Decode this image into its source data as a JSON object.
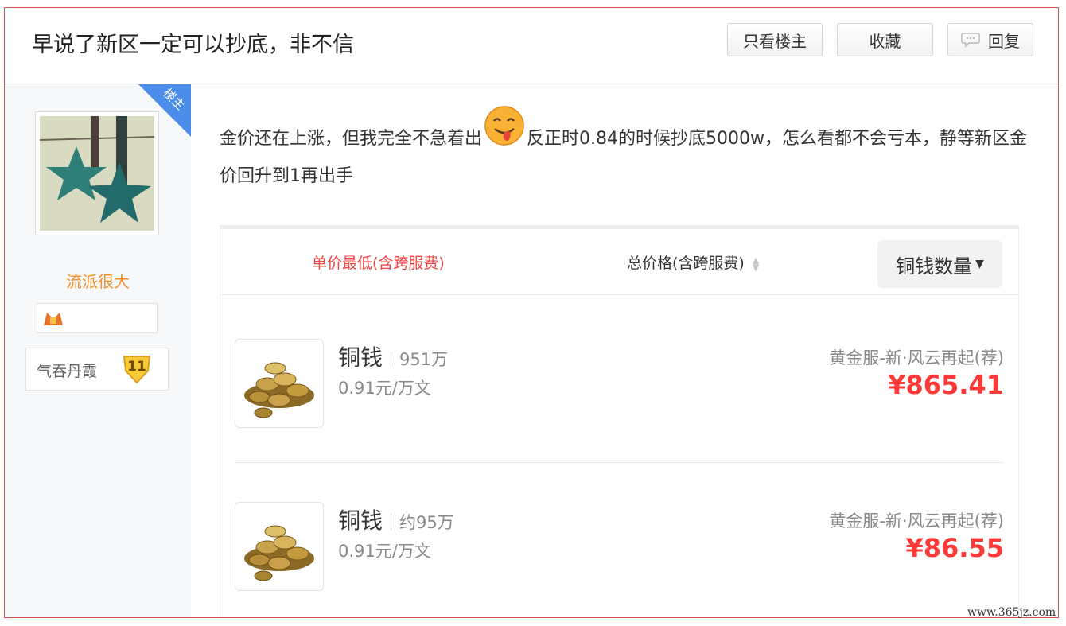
{
  "header": {
    "title": "早说了新区一定可以抄底，非不信",
    "only_op_label": "只看楼主",
    "favorite_label": "收藏",
    "reply_label": "回复"
  },
  "author": {
    "ribbon_label": "楼主",
    "username": "流派很大",
    "level_name": "气吞丹霞",
    "level": "11"
  },
  "post": {
    "text_before_emoji": "金价还在上涨，但我完全不急着出",
    "text_after_emoji": "反正时0.84的时候抄底5000w，怎么看都不会亏本，静等新区金价回升到1再出手"
  },
  "listing": {
    "sort_unit_label": "单价最低(含跨服费)",
    "sort_total_label": "总价格(含跨服费)",
    "sort_qty_label": "铜钱数量",
    "items": [
      {
        "name": "铜钱",
        "amount": "951万",
        "unit_price": "0.91元/万文",
        "server": "黄金服-新·风云再起(荐)",
        "price": "¥865.41"
      },
      {
        "name": "铜钱",
        "amount": "约95万",
        "unit_price": "0.91元/万文",
        "server": "黄金服-新·风云再起(荐)",
        "price": "¥86.55"
      }
    ]
  },
  "watermark": "www.365jz.com",
  "colors": {
    "accent_red": "#ff3838",
    "username_orange": "#f08f2b",
    "ribbon_blue": "#4c8dea"
  }
}
